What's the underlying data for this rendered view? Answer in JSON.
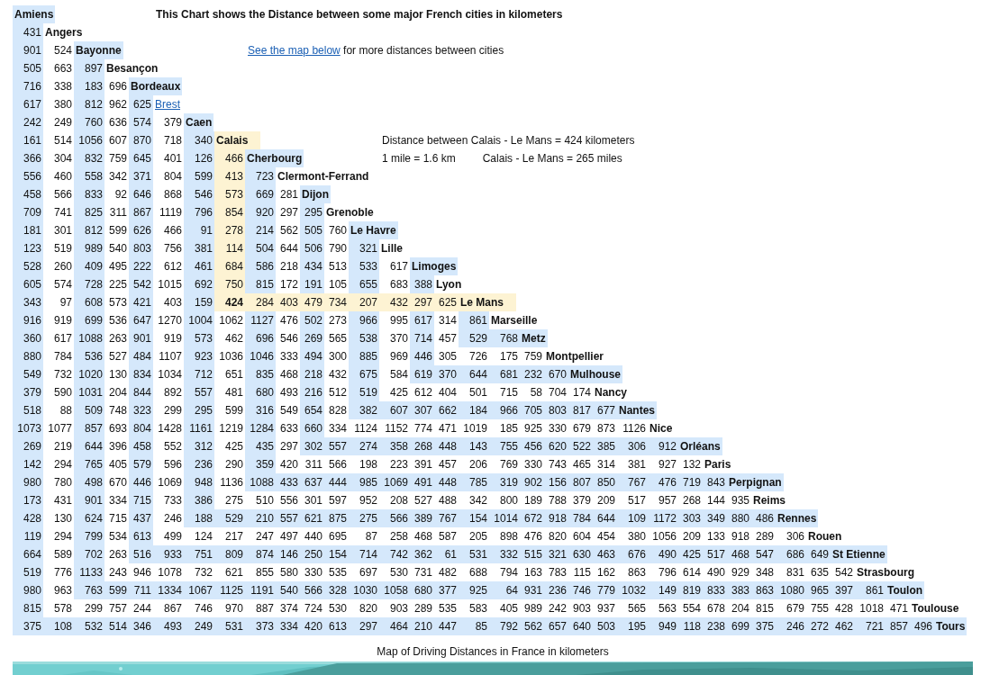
{
  "title": "This Chart shows the Distance between some major French cities in kilometers",
  "map_note": {
    "link": "See the map below",
    "text": "for more distances between cities"
  },
  "distance_note": "Distance between Calais - Le Mans = 424 kilometers",
  "conversion_note": "1 mile = 1.6 km",
  "miles_note": "Calais - Le Mans = 265 miles",
  "cities": [
    {
      "name": "Amiens",
      "selected": false,
      "link": false
    },
    {
      "name": "Angers",
      "selected": false,
      "link": false,
      "distances": [
        "431"
      ]
    },
    {
      "name": "Bayonne",
      "selected": false,
      "link": false,
      "distances": [
        "901",
        "524"
      ]
    },
    {
      "name": "Besançon",
      "selected": false,
      "link": false,
      "distances": [
        "505",
        "663",
        "897"
      ]
    },
    {
      "name": "Bordeaux",
      "selected": false,
      "link": false,
      "distances": [
        "716",
        "338",
        "183",
        "696"
      ]
    },
    {
      "name": "Brest",
      "selected": false,
      "link": true,
      "distances": [
        "617",
        "380",
        "812",
        "962",
        "625"
      ]
    },
    {
      "name": "Caen",
      "selected": false,
      "link": false,
      "distances": [
        "242",
        "249",
        "760",
        "636",
        "574",
        "379"
      ]
    },
    {
      "name": "Calais",
      "selected": true,
      "link": false,
      "distances": [
        "161",
        "514",
        "1056",
        "607",
        "870",
        "718",
        "340"
      ]
    },
    {
      "name": "Cherbourg",
      "selected": false,
      "link": false,
      "distances": [
        "366",
        "304",
        "832",
        "759",
        "645",
        "401",
        "126",
        "466"
      ]
    },
    {
      "name": "Clermont-Ferrand",
      "selected": false,
      "link": false,
      "distances": [
        "556",
        "460",
        "558",
        "342",
        "371",
        "804",
        "599",
        "413",
        "723"
      ]
    },
    {
      "name": "Dijon",
      "selected": false,
      "link": false,
      "distances": [
        "458",
        "566",
        "833",
        "92",
        "646",
        "868",
        "546",
        "573",
        "669",
        "281"
      ]
    },
    {
      "name": "Grenoble",
      "selected": false,
      "link": false,
      "distances": [
        "709",
        "741",
        "825",
        "311",
        "867",
        "1119",
        "796",
        "854",
        "920",
        "297",
        "295"
      ]
    },
    {
      "name": "Le Havre",
      "selected": false,
      "link": false,
      "distances": [
        "181",
        "301",
        "812",
        "599",
        "626",
        "466",
        "91",
        "278",
        "214",
        "562",
        "505",
        "760"
      ]
    },
    {
      "name": "Lille",
      "selected": false,
      "link": false,
      "distances": [
        "123",
        "519",
        "989",
        "540",
        "803",
        "756",
        "381",
        "114",
        "504",
        "644",
        "506",
        "790",
        "321"
      ]
    },
    {
      "name": "Limoges",
      "selected": false,
      "link": false,
      "distances": [
        "528",
        "260",
        "409",
        "495",
        "222",
        "612",
        "461",
        "684",
        "586",
        "218",
        "434",
        "513",
        "533",
        "617"
      ]
    },
    {
      "name": "Lyon",
      "selected": false,
      "link": false,
      "distances": [
        "605",
        "574",
        "728",
        "225",
        "542",
        "1015",
        "692",
        "750",
        "815",
        "172",
        "191",
        "105",
        "655",
        "683",
        "388"
      ]
    },
    {
      "name": "Le Mans",
      "selected": true,
      "link": false,
      "distances": [
        "343",
        "97",
        "608",
        "573",
        "421",
        "403",
        "159",
        "424",
        "284",
        "403",
        "479",
        "734",
        "207",
        "432",
        "297",
        "625"
      ]
    },
    {
      "name": "Marseille",
      "selected": false,
      "link": false,
      "distances": [
        "916",
        "919",
        "699",
        "536",
        "647",
        "1270",
        "1004",
        "1062",
        "1127",
        "476",
        "502",
        "273",
        "966",
        "995",
        "617",
        "314",
        "861"
      ]
    },
    {
      "name": "Metz",
      "selected": false,
      "link": false,
      "distances": [
        "360",
        "617",
        "1088",
        "263",
        "901",
        "919",
        "573",
        "462",
        "696",
        "546",
        "269",
        "565",
        "538",
        "370",
        "714",
        "457",
        "529",
        "768"
      ]
    },
    {
      "name": "Montpellier",
      "selected": false,
      "link": false,
      "distances": [
        "880",
        "784",
        "536",
        "527",
        "484",
        "1107",
        "923",
        "1036",
        "1046",
        "333",
        "494",
        "300",
        "885",
        "969",
        "446",
        "305",
        "726",
        "175",
        "759"
      ]
    },
    {
      "name": "Mulhouse",
      "selected": false,
      "link": false,
      "distances": [
        "549",
        "732",
        "1020",
        "130",
        "834",
        "1034",
        "712",
        "651",
        "835",
        "468",
        "218",
        "432",
        "675",
        "584",
        "619",
        "370",
        "644",
        "681",
        "232",
        "670"
      ]
    },
    {
      "name": "Nancy",
      "selected": false,
      "link": false,
      "distances": [
        "379",
        "590",
        "1031",
        "204",
        "844",
        "892",
        "557",
        "481",
        "680",
        "493",
        "216",
        "512",
        "519",
        "425",
        "612",
        "404",
        "501",
        "715",
        "58",
        "704",
        "174"
      ]
    },
    {
      "name": "Nantes",
      "selected": false,
      "link": false,
      "distances": [
        "518",
        "88",
        "509",
        "748",
        "323",
        "299",
        "295",
        "599",
        "316",
        "549",
        "654",
        "828",
        "382",
        "607",
        "307",
        "662",
        "184",
        "966",
        "705",
        "803",
        "817",
        "677"
      ]
    },
    {
      "name": "Nice",
      "selected": false,
      "link": false,
      "distances": [
        "1073",
        "1077",
        "857",
        "693",
        "804",
        "1428",
        "1161",
        "1219",
        "1284",
        "633",
        "660",
        "334",
        "1124",
        "1152",
        "774",
        "471",
        "1019",
        "185",
        "925",
        "330",
        "679",
        "873",
        "1126"
      ]
    },
    {
      "name": "Orléans",
      "selected": false,
      "link": false,
      "distances": [
        "269",
        "219",
        "644",
        "396",
        "458",
        "552",
        "312",
        "425",
        "435",
        "297",
        "302",
        "557",
        "274",
        "358",
        "268",
        "448",
        "143",
        "755",
        "456",
        "620",
        "522",
        "385",
        "306",
        "912"
      ]
    },
    {
      "name": "Paris",
      "selected": false,
      "link": false,
      "distances": [
        "142",
        "294",
        "765",
        "405",
        "579",
        "596",
        "236",
        "290",
        "359",
        "420",
        "311",
        "566",
        "198",
        "223",
        "391",
        "457",
        "206",
        "769",
        "330",
        "743",
        "465",
        "314",
        "381",
        "927",
        "132"
      ]
    },
    {
      "name": "Perpignan",
      "selected": false,
      "link": false,
      "distances": [
        "980",
        "780",
        "498",
        "670",
        "446",
        "1069",
        "948",
        "1136",
        "1088",
        "433",
        "637",
        "444",
        "985",
        "1069",
        "491",
        "448",
        "785",
        "319",
        "902",
        "156",
        "807",
        "850",
        "767",
        "476",
        "719",
        "843"
      ]
    },
    {
      "name": "Reims",
      "selected": false,
      "link": false,
      "distances": [
        "173",
        "431",
        "901",
        "334",
        "715",
        "733",
        "386",
        "275",
        "510",
        "556",
        "301",
        "597",
        "952",
        "208",
        "527",
        "488",
        "342",
        "800",
        "189",
        "788",
        "379",
        "209",
        "517",
        "957",
        "268",
        "144",
        "935"
      ]
    },
    {
      "name": "Rennes",
      "selected": false,
      "link": false,
      "distances": [
        "428",
        "130",
        "624",
        "715",
        "437",
        "246",
        "188",
        "529",
        "210",
        "557",
        "621",
        "875",
        "275",
        "566",
        "389",
        "767",
        "154",
        "1014",
        "672",
        "918",
        "784",
        "644",
        "109",
        "1172",
        "303",
        "349",
        "880",
        "486"
      ]
    },
    {
      "name": "Rouen",
      "selected": false,
      "link": false,
      "distances": [
        "119",
        "294",
        "799",
        "534",
        "613",
        "499",
        "124",
        "217",
        "247",
        "497",
        "440",
        "695",
        "87",
        "258",
        "468",
        "587",
        "205",
        "898",
        "476",
        "820",
        "604",
        "454",
        "380",
        "1056",
        "209",
        "133",
        "918",
        "289",
        "306"
      ]
    },
    {
      "name": "St Etienne",
      "selected": false,
      "link": false,
      "distances": [
        "664",
        "589",
        "702",
        "263",
        "516",
        "933",
        "751",
        "809",
        "874",
        "146",
        "250",
        "154",
        "714",
        "742",
        "362",
        "61",
        "531",
        "332",
        "515",
        "321",
        "630",
        "463",
        "676",
        "490",
        "425",
        "517",
        "468",
        "547",
        "686",
        "649"
      ]
    },
    {
      "name": "Strasbourg",
      "selected": false,
      "link": false,
      "distances": [
        "519",
        "776",
        "1133",
        "243",
        "946",
        "1078",
        "732",
        "621",
        "855",
        "580",
        "330",
        "535",
        "697",
        "530",
        "731",
        "482",
        "688",
        "794",
        "163",
        "783",
        "115",
        "162",
        "863",
        "796",
        "614",
        "490",
        "929",
        "348",
        "831",
        "635",
        "542"
      ]
    },
    {
      "name": "Toulon",
      "selected": false,
      "link": false,
      "distances": [
        "980",
        "963",
        "763",
        "599",
        "711",
        "1334",
        "1067",
        "1125",
        "1191",
        "540",
        "566",
        "328",
        "1030",
        "1058",
        "680",
        "377",
        "925",
        "64",
        "931",
        "236",
        "746",
        "779",
        "1032",
        "149",
        "819",
        "833",
        "383",
        "863",
        "1080",
        "965",
        "397",
        "861"
      ]
    },
    {
      "name": "Toulouse",
      "selected": false,
      "link": false,
      "distances": [
        "815",
        "578",
        "299",
        "757",
        "244",
        "867",
        "746",
        "970",
        "887",
        "374",
        "724",
        "530",
        "820",
        "903",
        "289",
        "535",
        "583",
        "405",
        "989",
        "242",
        "903",
        "937",
        "565",
        "563",
        "554",
        "678",
        "204",
        "815",
        "679",
        "755",
        "428",
        "1018",
        "471"
      ]
    },
    {
      "name": "Tours",
      "selected": false,
      "link": false,
      "distances": [
        "375",
        "108",
        "532",
        "514",
        "346",
        "493",
        "249",
        "531",
        "373",
        "334",
        "420",
        "613",
        "297",
        "464",
        "210",
        "447",
        "85",
        "792",
        "562",
        "657",
        "640",
        "503",
        "195",
        "949",
        "118",
        "238",
        "699",
        "375",
        "246",
        "272",
        "462",
        "721",
        "857",
        "496"
      ]
    }
  ],
  "map_caption": "Map of Driving Distances in France in kilometers"
}
